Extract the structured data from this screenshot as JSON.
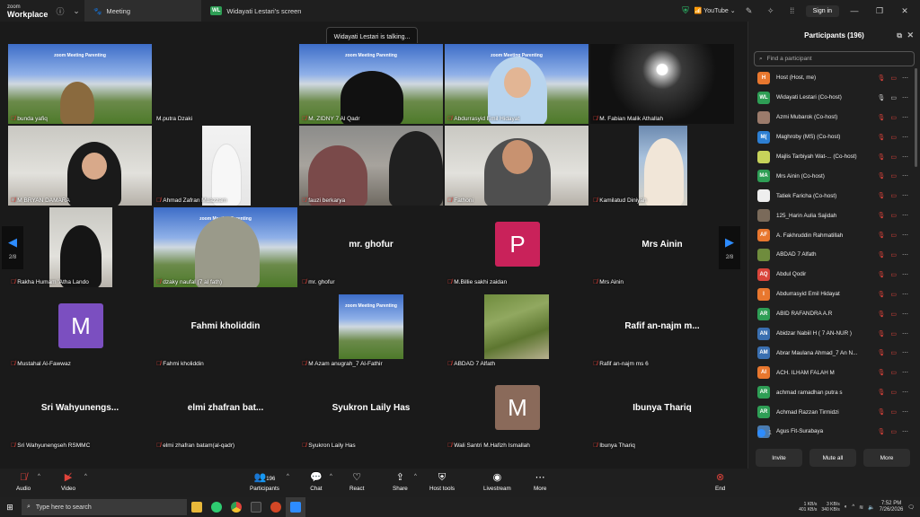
{
  "titlebar": {
    "brand_line1": "zoom",
    "brand_line2": "Workplace",
    "tabs": [
      {
        "label": "Meeting",
        "icon": "paw-icon",
        "active": true
      },
      {
        "label": "Widayati Lestari's screen",
        "badge": "WL",
        "active": false
      }
    ],
    "youtube_label": "YouTube",
    "signin_label": "Sign in"
  },
  "stage": {
    "talking_text": "Widayati Lestari is talking...",
    "pager_left": "2/8",
    "pager_right": "2/8",
    "tiles": [
      {
        "label": "bunda yafiq",
        "big": ""
      },
      {
        "label": "M.putra Dzaki",
        "big": ""
      },
      {
        "label": "M. ZIDNY 7 Al Qadr",
        "big": ""
      },
      {
        "label": "Abdurrasyid Emil Hidayat",
        "big": ""
      },
      {
        "label": "M. Fabian Malik Athallah",
        "big": ""
      },
      {
        "label": "M BRYAN DAMARA",
        "big": ""
      },
      {
        "label": "Ahmad Zafran Muazzam",
        "big": ""
      },
      {
        "label": "fauzi berkarya",
        "big": ""
      },
      {
        "label": "Fathoni",
        "big": ""
      },
      {
        "label": "Kamilatud Diniyah",
        "big": ""
      },
      {
        "label": "Rakha Humam 'Atha Lando",
        "big": ""
      },
      {
        "label": "dzaky naufal (7 al fath)",
        "big": ""
      },
      {
        "label": "mr. ghofur",
        "big": "mr. ghofur"
      },
      {
        "label": "M.Billie sakhi zaidan",
        "big": "",
        "avatar_letter": "P"
      },
      {
        "label": "Mrs Ainin",
        "big": "Mrs Ainin"
      },
      {
        "label": "Mustahal Al-Fawwaz",
        "big": "",
        "avatar_letter": "M"
      },
      {
        "label": "Fahmi kholiddin",
        "big": "Fahmi kholiddin"
      },
      {
        "label": "M Azam anugrah_7 Al-Fathir",
        "big": ""
      },
      {
        "label": "ABDAD 7 Alfath",
        "big": ""
      },
      {
        "label": "Rafif an-najm ms 6",
        "big": "Rafif an-najm m..."
      },
      {
        "label": "Sri Wahyunengseh RSMMC",
        "big": "Sri Wahyunengs..."
      },
      {
        "label": "elmi zhafran batam(al-qadr)",
        "big": "elmi zhafran bat..."
      },
      {
        "label": "Syukron Laily Has",
        "big": "Syukron Laily Has"
      },
      {
        "label": "Wali Santri M.Hafizh Ismallah",
        "big": "",
        "avatar_letter": "M"
      },
      {
        "label": "Ibunya Thariq",
        "big": "Ibunya Thariq"
      }
    ],
    "presentation_banner": "zoom Meeting Parenting"
  },
  "panel": {
    "title": "Participants (196)",
    "search_placeholder": "Find a participant",
    "raised_count": "1",
    "participants": [
      {
        "initials": "H",
        "name": "Host (Host, me)",
        "color": "#e8772e"
      },
      {
        "initials": "WL",
        "name": "Widayati Lestari (Co-host)",
        "color": "#2e9e55",
        "unmuted": true
      },
      {
        "initials": "",
        "name": "Azmi Mubarok (Co-host)",
        "color": "#9b7b6b"
      },
      {
        "initials": "M(",
        "name": "Maghroby (MS) (Co-host)",
        "color": "#2d7fd3"
      },
      {
        "initials": "",
        "name": "Majlis Tarbiyah Wat-... (Co-host)",
        "color": "#c7d35a"
      },
      {
        "initials": "MA",
        "name": "Mrs Ainin (Co-host)",
        "color": "#2e9e55"
      },
      {
        "initials": "",
        "name": "Tatiek Faricha (Co-host)",
        "color": "#eeeeee"
      },
      {
        "initials": "",
        "name": "125_Harin Aulia Sajidah",
        "color": "#7a6a5a"
      },
      {
        "initials": "AF",
        "name": "A. Fakhruddin Rahmatillah",
        "color": "#e8772e"
      },
      {
        "initials": "",
        "name": "ABDAD 7 Alfath",
        "color": "#6f8c3d"
      },
      {
        "initials": "AQ",
        "name": "Abdul Qodir",
        "color": "#d9453b"
      },
      {
        "initials": "I",
        "name": "Abdurrasyid Emil Hidayat",
        "color": "#e8772e"
      },
      {
        "initials": "AR",
        "name": "ABID RAFANDRA A.R",
        "color": "#2e9e55"
      },
      {
        "initials": "AN",
        "name": "Abidzar Nabiil H ( 7 AN-NUR )",
        "color": "#3a6fb0"
      },
      {
        "initials": "AM",
        "name": "Abrar Maulana Ahmad_7 An N...",
        "color": "#3a6fb0"
      },
      {
        "initials": "AI",
        "name": "ACH. ILHAM FALAH M",
        "color": "#e8772e"
      },
      {
        "initials": "AR",
        "name": "achmad ramadhan putra s",
        "color": "#2e9e55"
      },
      {
        "initials": "AR",
        "name": "Achmad Razzan Tirmidzi",
        "color": "#2e9e55"
      },
      {
        "initials": "",
        "name": "Agus Fit-Surabaya",
        "color": "#4a7bb0"
      }
    ],
    "invite_label": "Invite",
    "mute_all_label": "Mute all",
    "more_label": "More"
  },
  "toolbar": {
    "audio": "Audio",
    "video": "Video",
    "participants": "Participants",
    "participants_count": "196",
    "chat": "Chat",
    "react": "React",
    "share": "Share",
    "host_tools": "Host tools",
    "livestream": "Livestream",
    "more": "More",
    "end": "End"
  },
  "taskbar": {
    "search_placeholder": "Type here to search",
    "net_up": "1 KB/s",
    "net_down": "401 KB/s",
    "net_up2": "3 KB/s",
    "net_down2": "340 KB/s",
    "time": "7:52 PM",
    "date": "7/26/2026"
  }
}
